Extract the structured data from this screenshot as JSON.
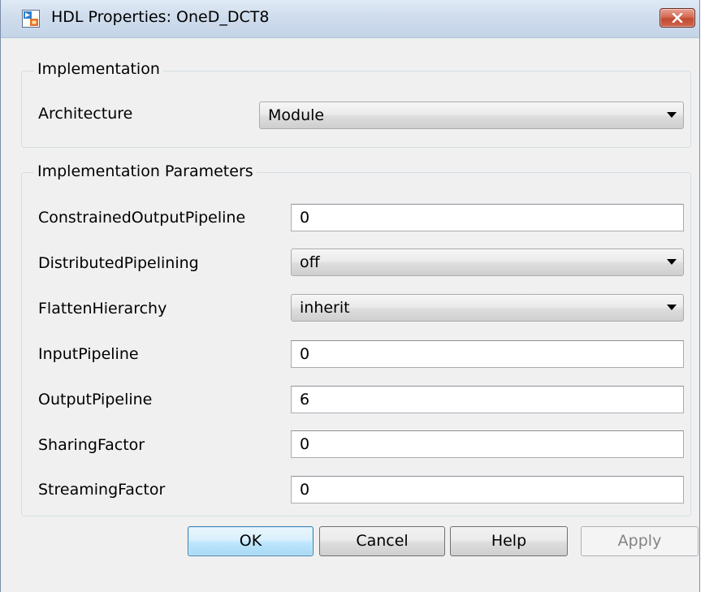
{
  "window": {
    "title": "HDL Properties: OneD_DCT8"
  },
  "implementation": {
    "legend": "Implementation",
    "architecture_label": "Architecture",
    "architecture_value": "Module"
  },
  "parameters": {
    "legend": "Implementation Parameters",
    "rows": [
      {
        "label": "ConstrainedOutputPipeline",
        "value": "0",
        "kind": "text"
      },
      {
        "label": "DistributedPipelining",
        "value": "off",
        "kind": "dropdown"
      },
      {
        "label": "FlattenHierarchy",
        "value": "inherit",
        "kind": "dropdown"
      },
      {
        "label": "InputPipeline",
        "value": "0",
        "kind": "text"
      },
      {
        "label": "OutputPipeline",
        "value": "6",
        "kind": "text"
      },
      {
        "label": "SharingFactor",
        "value": "0",
        "kind": "text"
      },
      {
        "label": "StreamingFactor",
        "value": "0",
        "kind": "text"
      }
    ]
  },
  "buttons": {
    "ok": "OK",
    "cancel": "Cancel",
    "help": "Help",
    "apply": "Apply"
  },
  "icons": {
    "app": "simulink-block-icon",
    "close": "close-icon",
    "dropdown": "chevron-down-icon"
  },
  "colors": {
    "close_button": "#c94f37",
    "default_button_border": "#3c7fb1",
    "dialog_background": "#f0f0f0"
  }
}
